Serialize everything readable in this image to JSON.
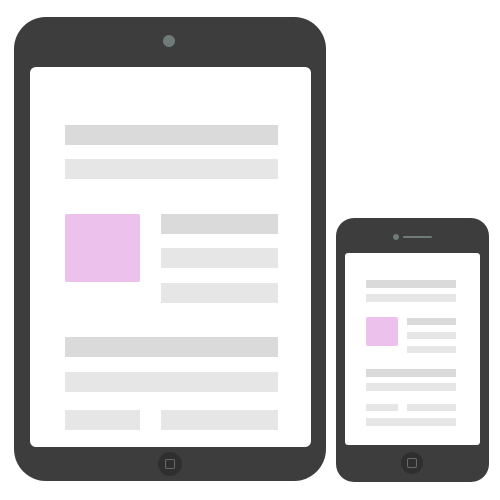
{
  "colors": {
    "device": "#3d3d3d",
    "screen": "#ffffff",
    "placeholder_dark": "#dadada",
    "placeholder_light": "#e6e6e6",
    "image_placeholder": "#ecc1ec"
  },
  "devices": [
    {
      "type": "tablet",
      "icons": [
        "camera-icon",
        "home-button-icon"
      ]
    },
    {
      "type": "phone",
      "icons": [
        "camera-icon",
        "speaker-icon",
        "home-button-icon"
      ]
    }
  ]
}
